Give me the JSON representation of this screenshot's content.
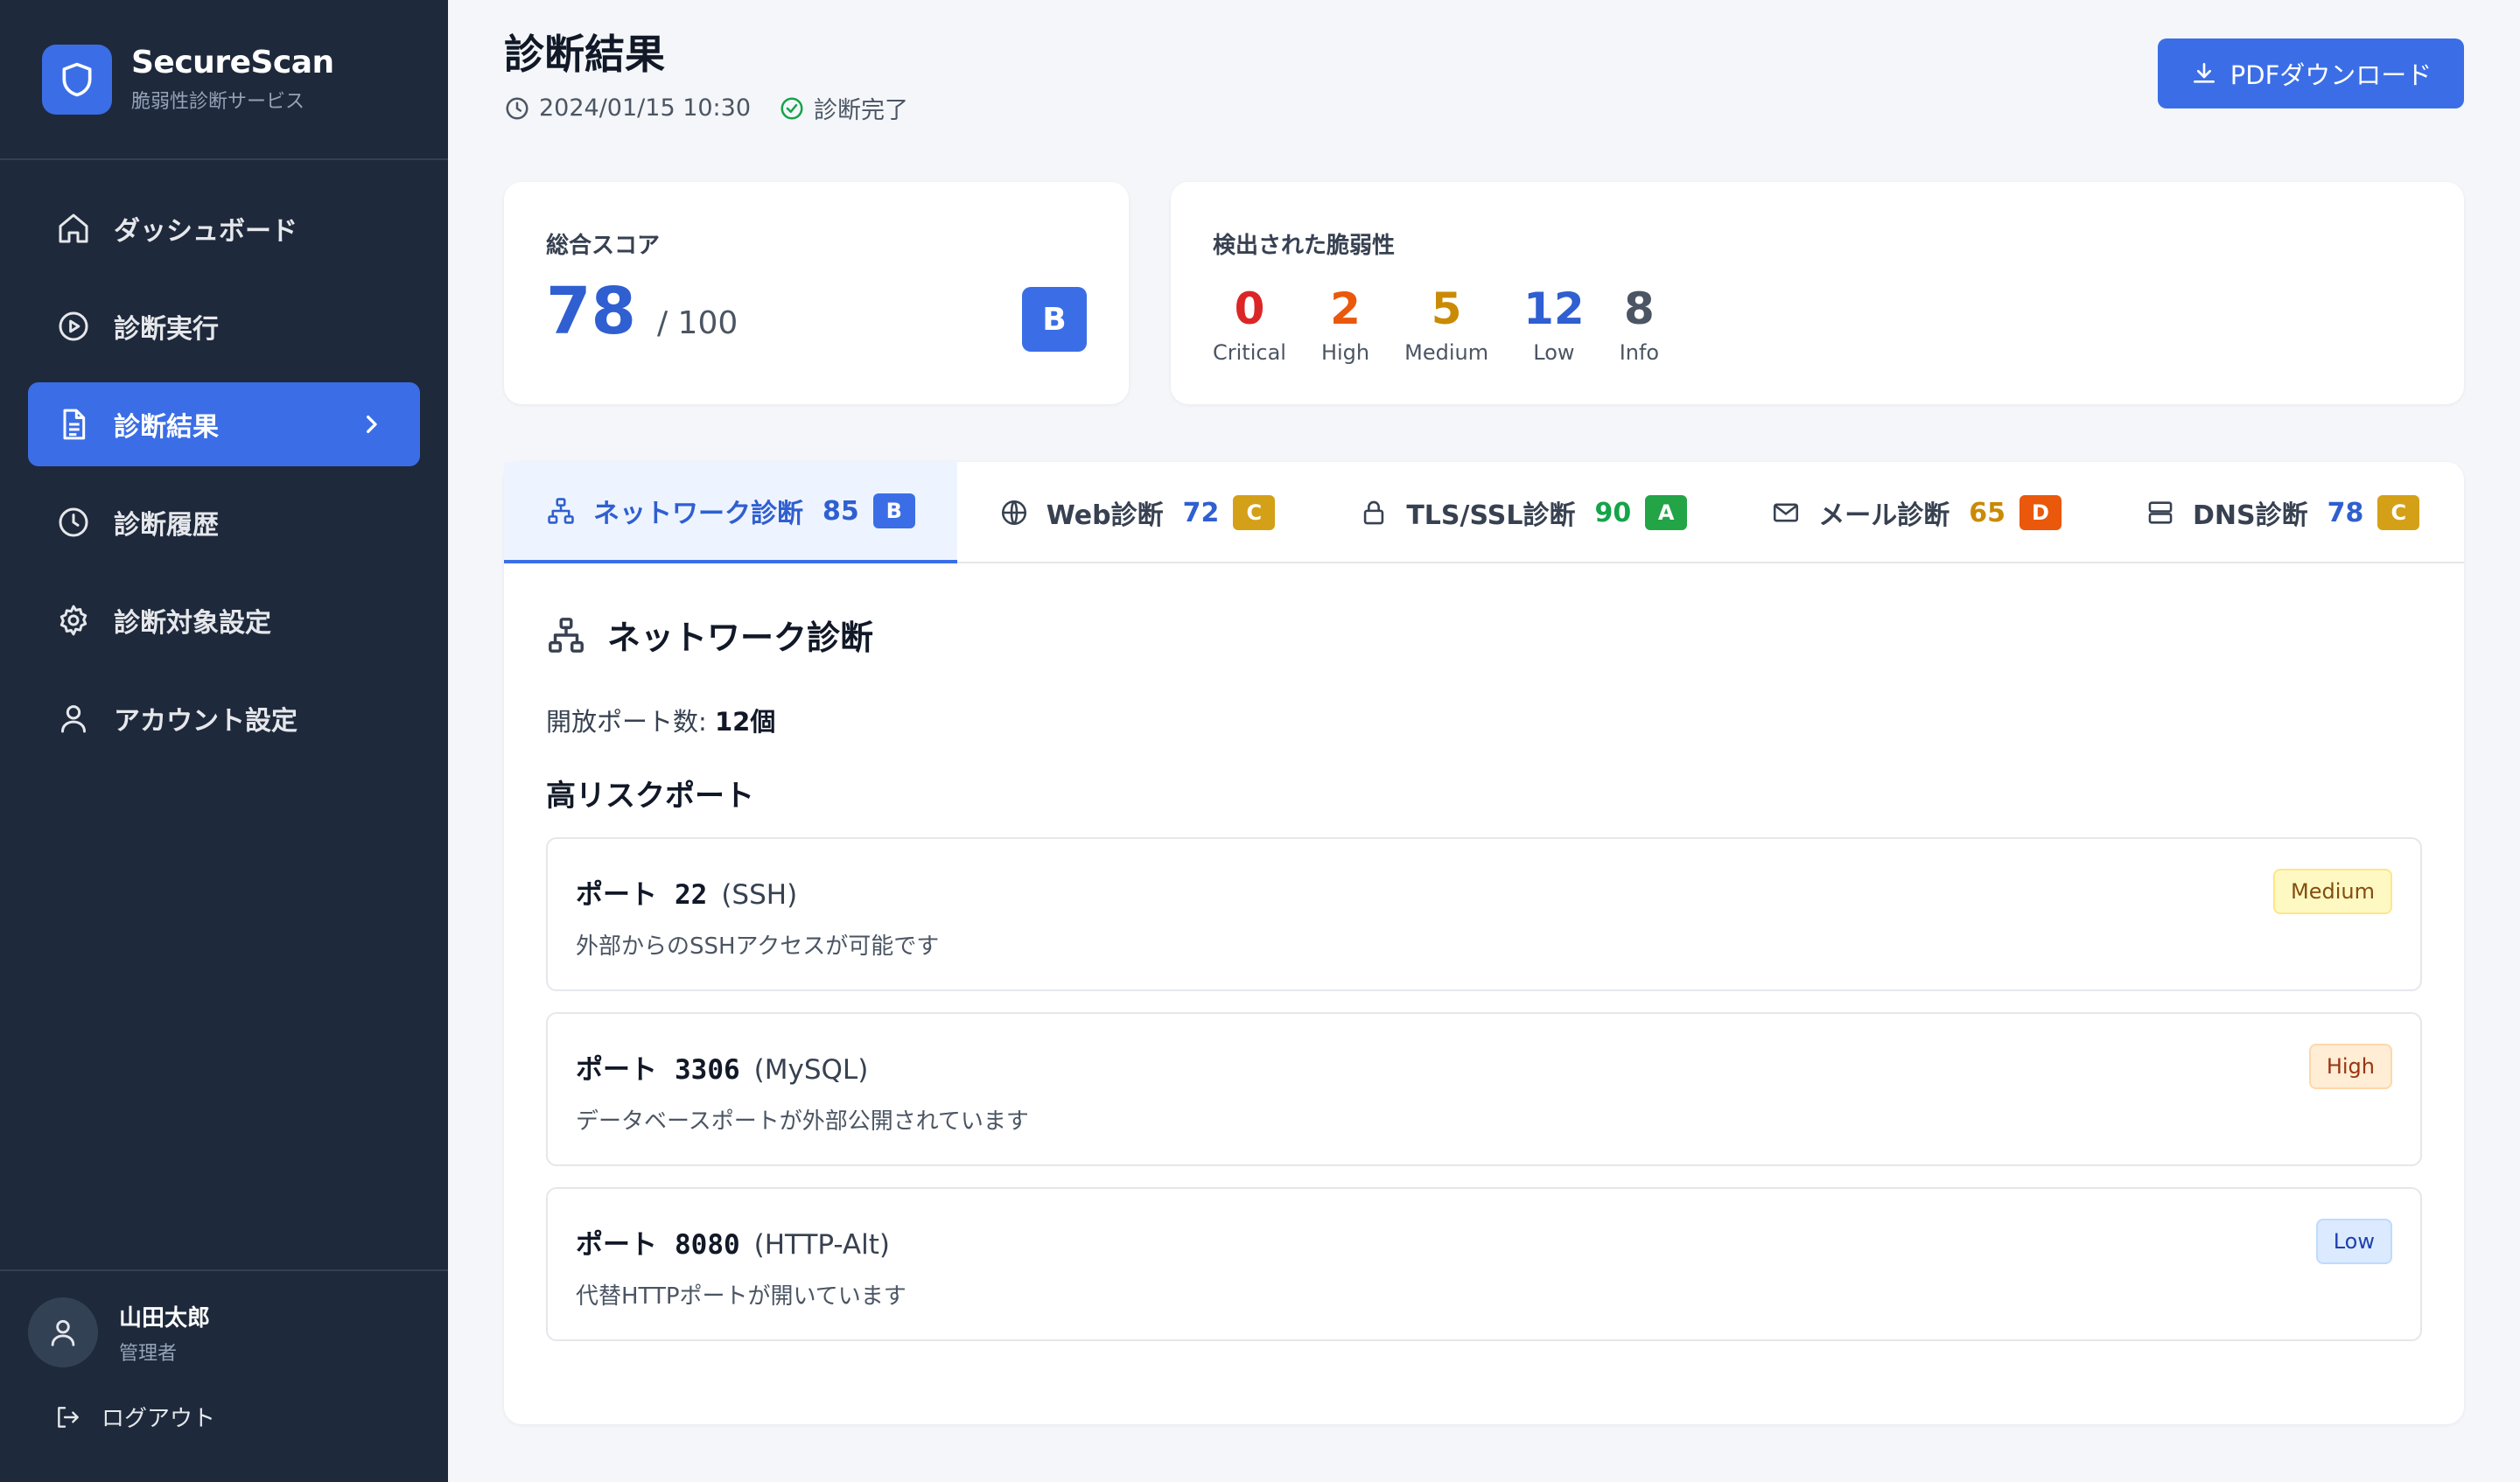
{
  "brand": {
    "name": "SecureScan",
    "subtitle": "脆弱性診断サービス"
  },
  "nav": [
    {
      "label": "ダッシュボード",
      "icon": "home-icon"
    },
    {
      "label": "診断実行",
      "icon": "play-circle-icon"
    },
    {
      "label": "診断結果",
      "icon": "document-icon",
      "active": true
    },
    {
      "label": "診断履歴",
      "icon": "clock-icon"
    },
    {
      "label": "診断対象設定",
      "icon": "gear-icon"
    },
    {
      "label": "アカウント設定",
      "icon": "user-icon"
    }
  ],
  "user": {
    "name": "山田太郎",
    "role": "管理者"
  },
  "logout_label": "ログアウト",
  "header": {
    "title": "診断結果",
    "datetime": "2024/01/15 10:30",
    "status": "診断完了",
    "pdf_button": "PDFダウンロード"
  },
  "score": {
    "label": "総合スコア",
    "value": "78",
    "max": "/ 100",
    "grade": "B"
  },
  "vulnerabilities": {
    "label": "検出された脆弱性",
    "items": [
      {
        "count": "0",
        "label": "Critical",
        "color": "#dc2626"
      },
      {
        "count": "2",
        "label": "High",
        "color": "#ea580c"
      },
      {
        "count": "5",
        "label": "Medium",
        "color": "#ca8a04"
      },
      {
        "count": "12",
        "label": "Low",
        "color": "#2f5fd0"
      },
      {
        "count": "8",
        "label": "Info",
        "color": "#4b5563"
      }
    ]
  },
  "tabs": [
    {
      "label": "ネットワーク診断",
      "score": "85",
      "grade": "B",
      "icon": "network-icon",
      "score_color": "#2f5fd0",
      "grade_color": "#3b6ee6",
      "active": true
    },
    {
      "label": "Web診断",
      "score": "72",
      "grade": "C",
      "icon": "globe-icon",
      "score_color": "#2f5fd0",
      "grade_color": "#d4a017"
    },
    {
      "label": "TLS/SSL診断",
      "score": "90",
      "grade": "A",
      "icon": "lock-icon",
      "score_color": "#16a34a",
      "grade_color": "#22a447"
    },
    {
      "label": "メール診断",
      "score": "65",
      "grade": "D",
      "icon": "mail-icon",
      "score_color": "#ca8a04",
      "grade_color": "#ea580c"
    },
    {
      "label": "DNS診断",
      "score": "78",
      "grade": "C",
      "icon": "server-icon",
      "score_color": "#2f5fd0",
      "grade_color": "#d4a017"
    }
  ],
  "section": {
    "title": "ネットワーク診断",
    "open_ports_label": "開放ポート数: ",
    "open_ports_value": "12個",
    "high_risk_title": "高リスクポート",
    "ports": [
      {
        "label": "ポート",
        "number": "22",
        "service": "(SSH)",
        "desc": "外部からのSSHアクセスが可能です",
        "severity": "Medium"
      },
      {
        "label": "ポート",
        "number": "3306",
        "service": "(MySQL)",
        "desc": "データベースポートが外部公開されています",
        "severity": "High"
      },
      {
        "label": "ポート",
        "number": "8080",
        "service": "(HTTP-Alt)",
        "desc": "代替HTTPポートが開いています",
        "severity": "Low"
      }
    ]
  }
}
